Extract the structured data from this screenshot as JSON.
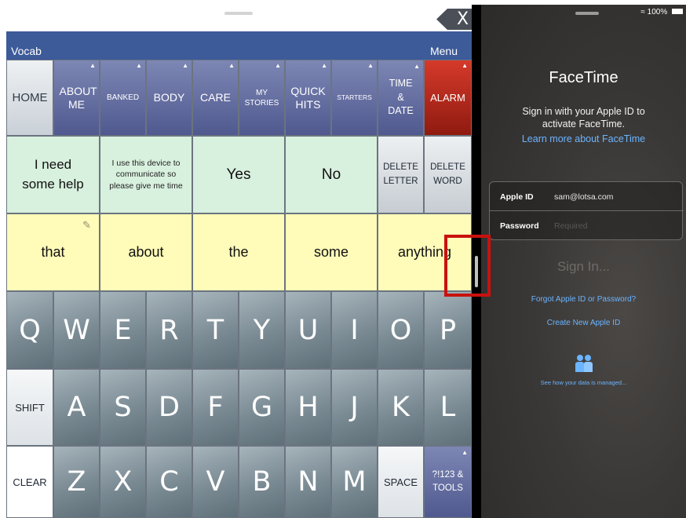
{
  "aac": {
    "close_label": "X",
    "vocab_label": "Vocab",
    "menu_label": "Menu",
    "nav_buttons": [
      {
        "label": "HOME"
      },
      {
        "label": "ABOUT ME"
      },
      {
        "label": "BANKED"
      },
      {
        "label": "BODY"
      },
      {
        "label": "CARE"
      },
      {
        "label": "MY STORIES"
      },
      {
        "label": "QUICK HITS"
      },
      {
        "label": "STARTERS"
      },
      {
        "label": "TIME & DATE"
      },
      {
        "label": "ALARM"
      }
    ],
    "phrases": [
      {
        "label": "I need some help"
      },
      {
        "label": "I use this device to communicate so please give me time"
      },
      {
        "label": "Yes"
      },
      {
        "label": "No"
      }
    ],
    "delete_letter_label": "DELETE LETTER",
    "delete_word_label": "DELETE WORD",
    "words": [
      {
        "label": "that"
      },
      {
        "label": "about"
      },
      {
        "label": "the"
      },
      {
        "label": "some"
      },
      {
        "label": "anything"
      }
    ],
    "keyboard": {
      "row1": [
        "Q",
        "W",
        "E",
        "R",
        "T",
        "Y",
        "U",
        "I",
        "O",
        "P"
      ],
      "shift_label": "SHIFT",
      "row2": [
        "A",
        "S",
        "D",
        "F",
        "G",
        "H",
        "J",
        "K",
        "L"
      ],
      "clear_label": "CLEAR",
      "row3": [
        "Z",
        "X",
        "C",
        "V",
        "B",
        "N",
        "M"
      ],
      "space_label": "SPACE",
      "tools_label": "?!123 & TOOLS"
    },
    "highlight_color": "#c8120e"
  },
  "facetime": {
    "status_battery": "100%",
    "title": "FaceTime",
    "subtitle": "Sign in with your Apple ID to activate FaceTime.",
    "learn_more": "Learn more about FaceTime",
    "apple_id_label": "Apple ID",
    "apple_id_value": "sam@lotsa.com",
    "password_label": "Password",
    "password_placeholder": "Required",
    "sign_in_label": "Sign In...",
    "forgot_label": "Forgot Apple ID or Password?",
    "create_label": "Create New Apple ID",
    "privacy_icon": "privacy-handshake-icon",
    "privacy_label": "See how your data is managed...",
    "link_color": "#6bb4ff"
  }
}
